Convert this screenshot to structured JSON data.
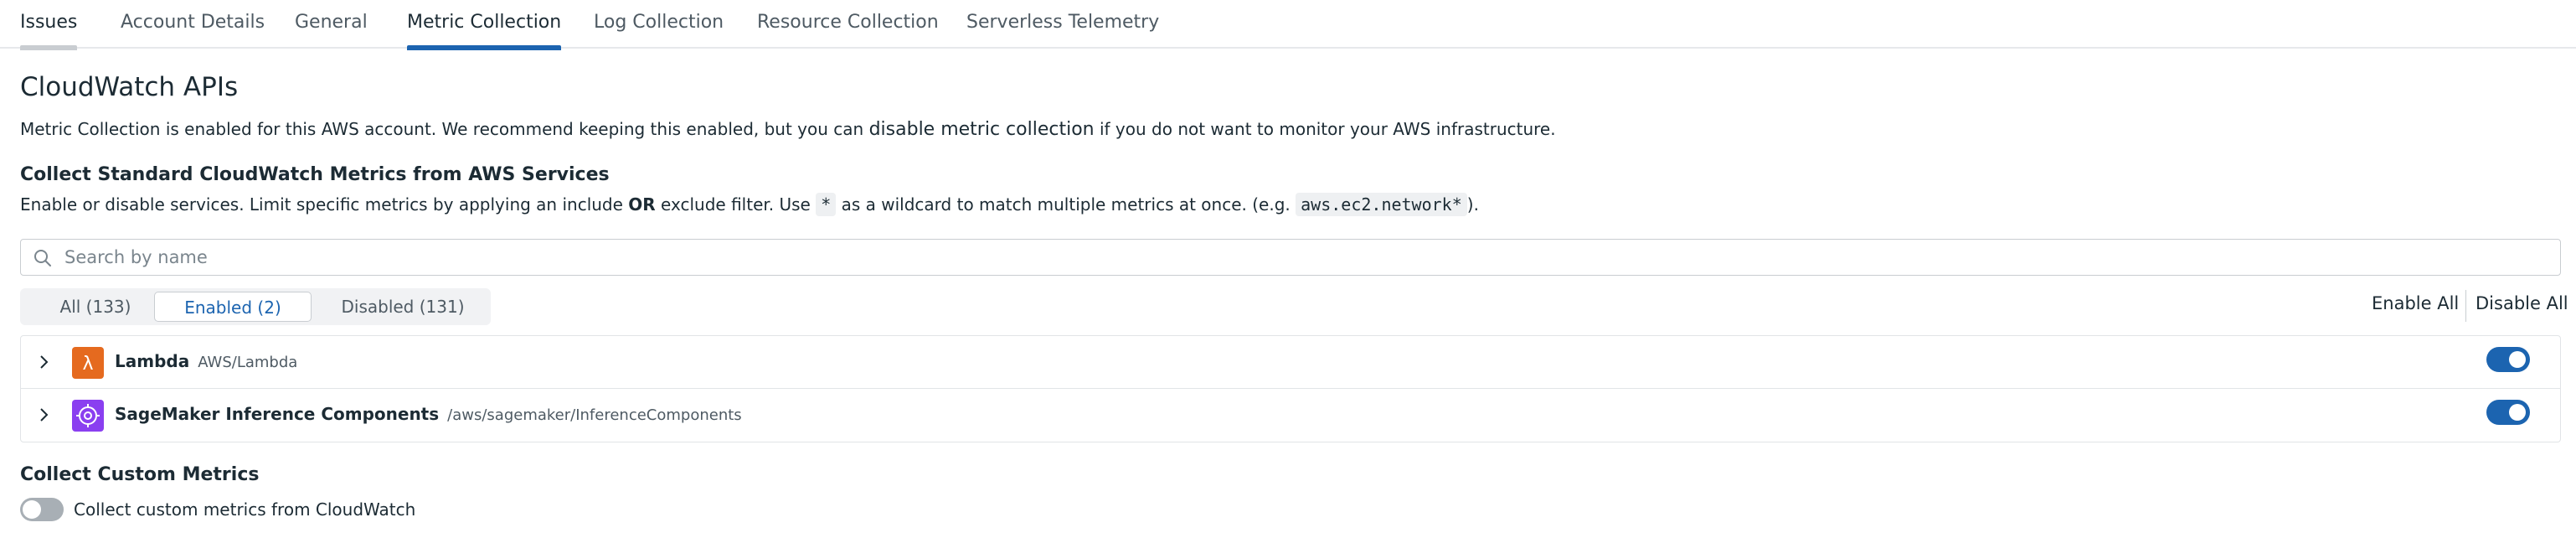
{
  "tabs": [
    {
      "label": "Issues"
    },
    {
      "label": "Account Details"
    },
    {
      "label": "General"
    },
    {
      "label": "Metric Collection"
    },
    {
      "label": "Log Collection"
    },
    {
      "label": "Resource Collection"
    },
    {
      "label": "Serverless Telemetry"
    }
  ],
  "active_tab": "Metric Collection",
  "section": {
    "title": "CloudWatch APIs",
    "desc_pre": "Metric Collection is enabled for this AWS account. We recommend keeping this enabled, but you can ",
    "desc_link": "disable metric collection",
    "desc_post": " if you do not want to monitor your AWS infrastructure."
  },
  "standard": {
    "heading": "Collect Standard CloudWatch Metrics from AWS Services",
    "desc_a": "Enable or disable services. Limit specific metrics by applying an include ",
    "desc_or": "OR",
    "desc_b": " exclude filter. Use ",
    "desc_wild": "*",
    "desc_c": " as a wildcard to match multiple metrics at once. (e.g. ",
    "desc_example": "aws.ec2.network*",
    "desc_d": ")."
  },
  "search": {
    "placeholder": "Search by name",
    "value": ""
  },
  "filters": [
    {
      "label": "All (133)"
    },
    {
      "label": "Enabled (2)"
    },
    {
      "label": "Disabled (131)"
    }
  ],
  "selected_filter": "Enabled (2)",
  "actions": {
    "enable_all": "Enable All",
    "disable_all": "Disable All"
  },
  "services": [
    {
      "name": "Lambda",
      "namespace": "AWS/Lambda",
      "icon": "lambda-icon",
      "enabled": true,
      "color": "#e56a1f"
    },
    {
      "name": "SageMaker Inference Components",
      "namespace": "/aws/sagemaker/InferenceComponents",
      "icon": "sagemaker-icon",
      "enabled": true,
      "color": "#8a3ff0"
    }
  ],
  "custom": {
    "heading": "Collect Custom Metrics",
    "toggle_label": "Collect custom metrics from CloudWatch",
    "enabled": false
  },
  "colors": {
    "accent": "#1c64b0",
    "toggle_off": "#a8afb5"
  }
}
